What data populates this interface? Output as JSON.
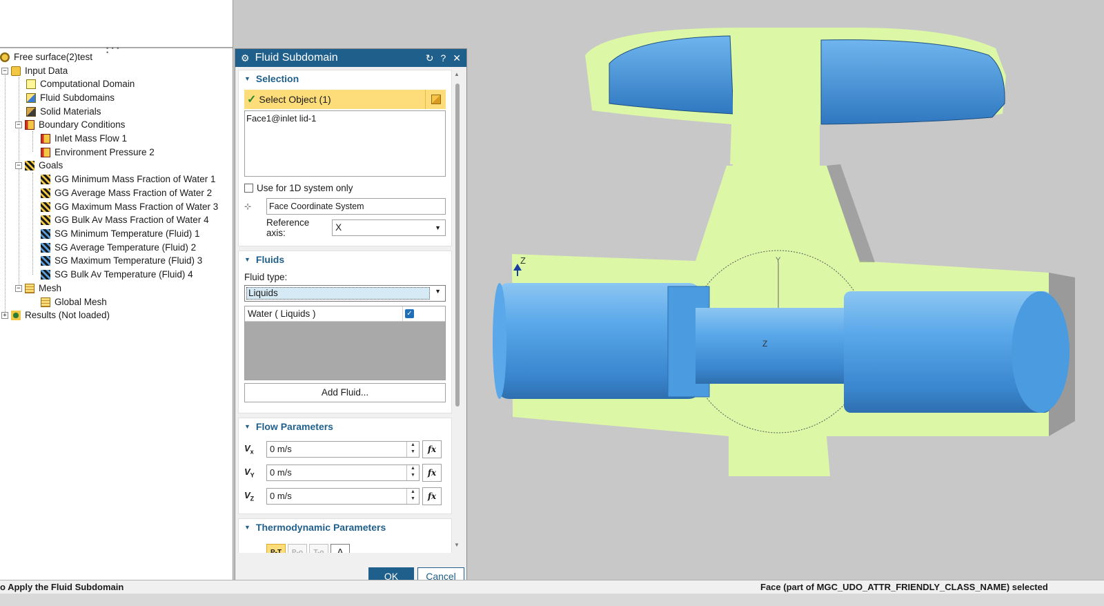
{
  "tree": {
    "project": "Free surface(2)test",
    "input_data": "Input Data",
    "computational_domain": "Computational Domain",
    "fluid_subdomains": "Fluid Subdomains",
    "solid_materials": "Solid Materials",
    "boundary_conditions": "Boundary Conditions",
    "inlet_mass_flow": "Inlet Mass Flow 1",
    "environment_pressure": "Environment Pressure 2",
    "goals": "Goals",
    "goal_items": [
      "GG Minimum Mass Fraction of Water 1",
      "GG Average Mass Fraction of Water 2",
      "GG Maximum Mass Fraction of Water 3",
      "GG Bulk Av Mass Fraction of Water 4",
      "SG Minimum Temperature (Fluid) 1",
      "SG Average Temperature (Fluid) 2",
      "SG Maximum Temperature (Fluid) 3",
      "SG Bulk Av Temperature (Fluid) 4"
    ],
    "mesh": "Mesh",
    "global_mesh": "Global Mesh",
    "results": "Results (Not loaded)",
    "collapse_sign": "−",
    "expand_sign": "+"
  },
  "dialog": {
    "title": "Fluid Subdomain",
    "selection": {
      "header": "Selection",
      "select_object": "Select Object (1)",
      "selected_item": "Face1@inlet lid-1",
      "use_1d_label": "Use for 1D system only",
      "coord_system": "Face Coordinate System",
      "reference_axis_label": "Reference axis:",
      "reference_axis_value": "X"
    },
    "fluids": {
      "header": "Fluids",
      "fluid_type_label": "Fluid type:",
      "fluid_type_value": "Liquids",
      "fluid_item": "Water ( Liquids )",
      "add_fluid": "Add Fluid..."
    },
    "flow": {
      "header": "Flow Parameters",
      "vx_label": "V",
      "vx_sub": "x",
      "vx_value": "0 m/s",
      "vy_label": "V",
      "vy_sub": "Y",
      "vy_value": "0 m/s",
      "vz_label": "V",
      "vz_sub": "Z",
      "vz_value": "0 m/s",
      "fx_label": "fx"
    },
    "thermo": {
      "header": "Thermodynamic Parameters",
      "tabs": [
        "P-T",
        "P-ρ",
        "T-ρ",
        "A"
      ]
    },
    "ok_label": "OK",
    "cancel_label": "Cancel"
  },
  "viewport": {
    "axis_z_label_top": "Z",
    "axis_y_label": "Y",
    "axis_z_center": "Z",
    "colors": {
      "fluid_green": "#dcf7a6",
      "part_blue": "#4a9be0",
      "background": "#c8c8c8"
    }
  },
  "status": {
    "left": "o Apply the Fluid Subdomain",
    "right": "Face (part of MGC_UDO_ATTR_FRIENDLY_CLASS_NAME) selected"
  }
}
